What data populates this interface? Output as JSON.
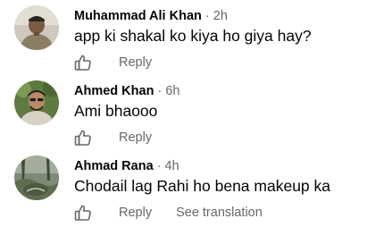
{
  "comments": [
    {
      "author": "Muhammad Ali Khan",
      "separator": "·",
      "time": "2h",
      "text": "app ki shakal ko kiya ho giya hay?",
      "reply_label": "Reply",
      "like_icon": "thumbs-up-outline-icon"
    },
    {
      "author": "Ahmed Khan",
      "separator": "·",
      "time": "6h",
      "text": "Ami bhaooo",
      "reply_label": "Reply",
      "like_icon": "thumbs-up-outline-icon"
    },
    {
      "author": "Ahmad Rana",
      "separator": "·",
      "time": "4h",
      "text": "Chodail lag Rahi ho bena makeup ka",
      "reply_label": "Reply",
      "see_translation_label": "See translation",
      "like_icon": "thumbs-up-outline-icon"
    }
  ],
  "colors": {
    "primary_text": "#050505",
    "secondary_text": "#65676b",
    "background": "#ffffff"
  }
}
